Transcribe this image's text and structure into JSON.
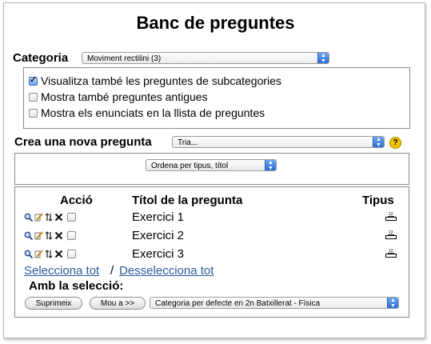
{
  "page_title": "Banc de preguntes",
  "category": {
    "label": "Categoria",
    "selected": "Moviment rectilini (3)"
  },
  "options": [
    {
      "label": "Visualitza també les preguntes de subcategories",
      "checked": true
    },
    {
      "label": "Mostra també preguntes antigues",
      "checked": false
    },
    {
      "label": "Mostra els enunciats en la llista de preguntes",
      "checked": false
    }
  ],
  "create": {
    "label": "Crea una nova pregunta",
    "selected": "Tria...",
    "help_icon": "help-icon"
  },
  "sort": {
    "selected": "Ordena per tipus, títol"
  },
  "table": {
    "headers": {
      "action": "Acció",
      "title": "Títol de la pregunta",
      "type": "Tipus"
    },
    "rows": [
      {
        "name": "Exercici 1",
        "type_icon": "numerical-question-icon",
        "checked": false
      },
      {
        "name": "Exercici 2",
        "type_icon": "numerical-question-icon",
        "checked": false
      },
      {
        "name": "Exercici 3",
        "type_icon": "numerical-question-icon",
        "checked": false
      }
    ]
  },
  "selection": {
    "select_all": "Selecciona tot",
    "separator": "/",
    "deselect_all": "Desselecciona tot",
    "with_selection_label": "Amb la selecció:",
    "delete_button": "Suprimeix",
    "move_button": "Mou a >>",
    "target_category": "Categoria per defecte en 2n Batxillerat - Física"
  },
  "colors": {
    "select_arrow": "#2b6fd6",
    "link": "#2a5b9c",
    "help": "#f2c400"
  }
}
